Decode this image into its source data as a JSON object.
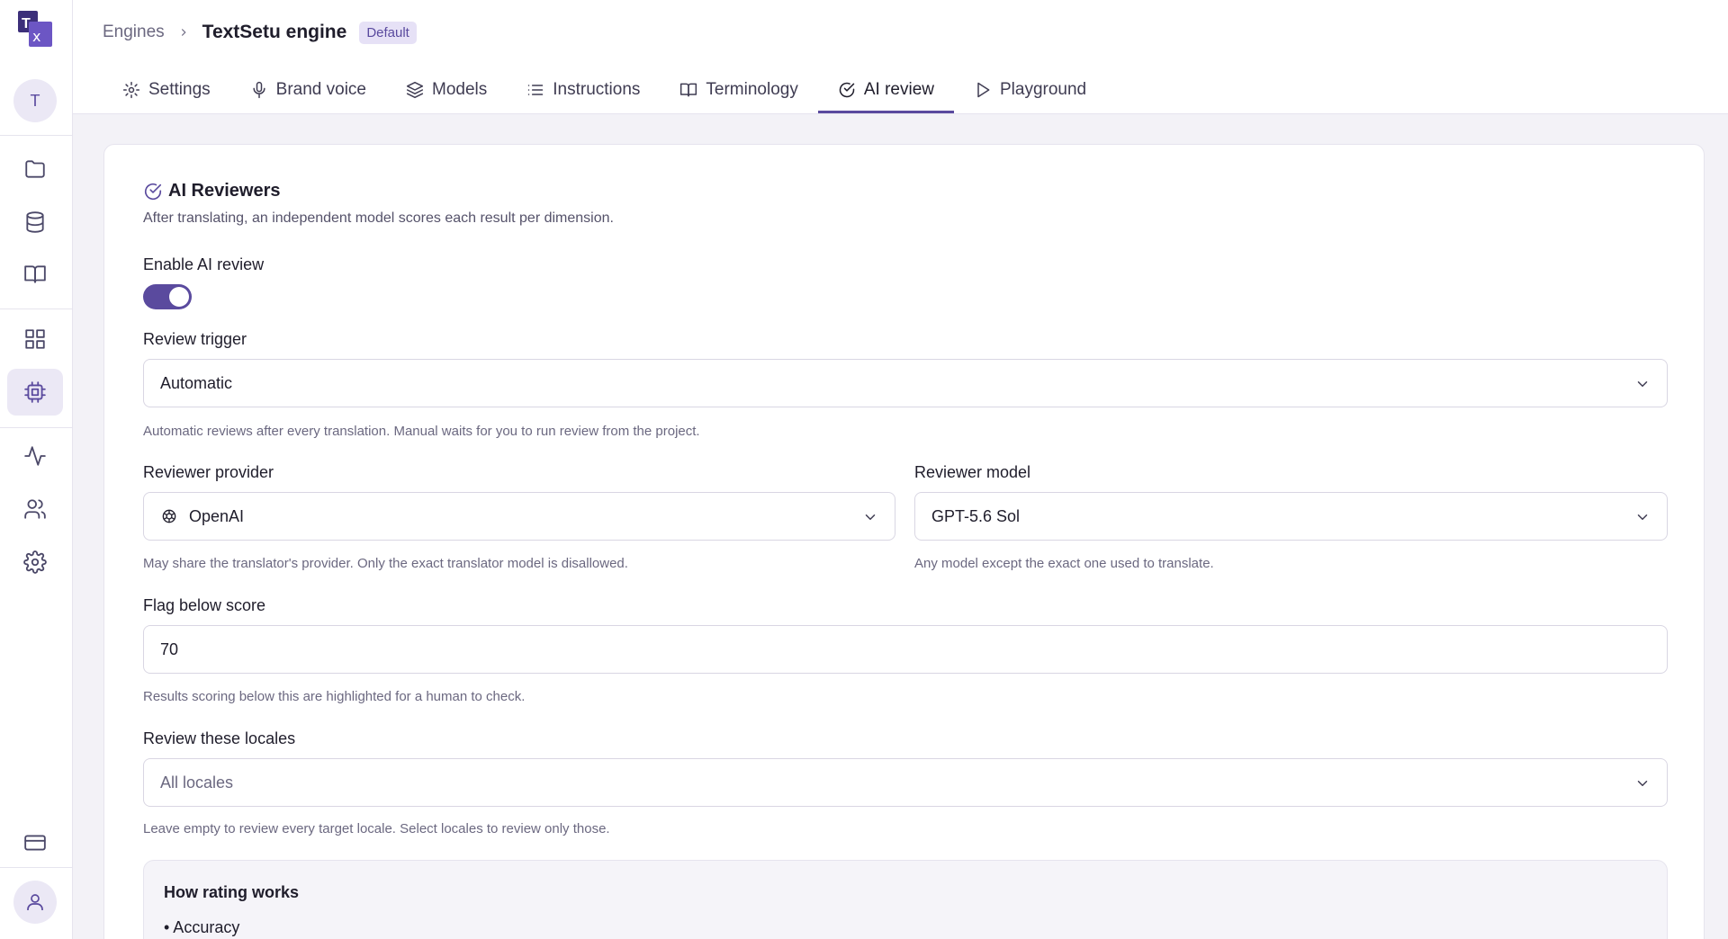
{
  "app": {
    "logo_text": "T文",
    "avatar_letter": "T"
  },
  "breadcrumb": {
    "parent": "Engines",
    "title": "TextSetu engine",
    "badge": "Default"
  },
  "tabs": [
    {
      "label": "Settings",
      "icon": "gear-icon"
    },
    {
      "label": "Brand voice",
      "icon": "microphone-icon"
    },
    {
      "label": "Models",
      "icon": "layers-icon"
    },
    {
      "label": "Instructions",
      "icon": "list-icon"
    },
    {
      "label": "Terminology",
      "icon": "book-icon"
    },
    {
      "label": "AI review",
      "icon": "check-circle-icon",
      "active": true
    },
    {
      "label": "Playground",
      "icon": "play-icon"
    }
  ],
  "section": {
    "title": "AI Reviewers",
    "subtitle": "After translating, an independent model scores each result per dimension."
  },
  "enable": {
    "label": "Enable AI review",
    "on": true
  },
  "trigger": {
    "label": "Review trigger",
    "value": "Automatic",
    "help": "Automatic reviews after every translation. Manual waits for you to run review from the project."
  },
  "provider": {
    "label": "Reviewer provider",
    "value": "OpenAI",
    "help": "May share the translator's provider. Only the exact translator model is disallowed."
  },
  "model": {
    "label": "Reviewer model",
    "value": "GPT-5.6 Sol",
    "help": "Any model except the exact one used to translate."
  },
  "threshold": {
    "label": "Flag below score",
    "value": "70",
    "help": "Results scoring below this are highlighted for a human to check."
  },
  "locales": {
    "label": "Review these locales",
    "placeholder": "All locales",
    "help": "Leave empty to review every target locale. Select locales to review only those."
  },
  "rating": {
    "title": "How rating works",
    "items": [
      "• Accuracy"
    ]
  },
  "colors": {
    "accent": "#5a4a9e",
    "accent_light": "#ebe8f5"
  }
}
